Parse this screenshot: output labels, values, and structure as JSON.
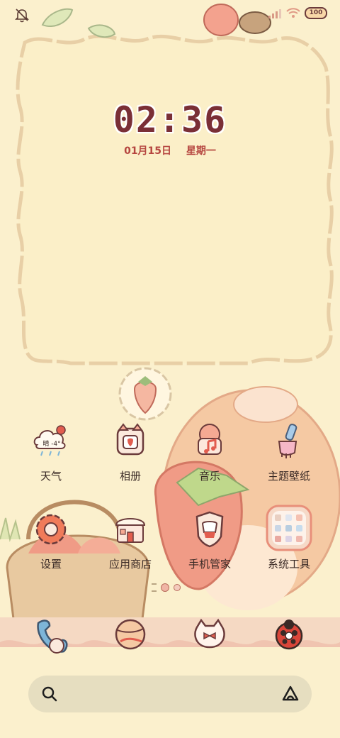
{
  "status_bar": {
    "battery": "100",
    "icons": [
      "mute-bell-icon",
      "signal-icon",
      "wifi-icon",
      "battery-icon"
    ]
  },
  "lockclock": {
    "time": "02:36",
    "date": "01月15日",
    "weekday": "星期一"
  },
  "apps": [
    {
      "label": "天气",
      "icon": "weather-icon",
      "weather_text": "晴 -4°"
    },
    {
      "label": "相册",
      "icon": "album-icon"
    },
    {
      "label": "音乐",
      "icon": "music-icon"
    },
    {
      "label": "主题壁纸",
      "icon": "theme-icon"
    },
    {
      "label": "设置",
      "icon": "settings-icon"
    },
    {
      "label": "应用商店",
      "icon": "app-store-icon"
    },
    {
      "label": "手机管家",
      "icon": "phone-manager-icon"
    },
    {
      "label": "系统工具",
      "icon": "system-tools-folder-icon"
    }
  ],
  "dock": [
    {
      "icon": "phone-icon"
    },
    {
      "icon": "browser-icon"
    },
    {
      "icon": "messages-icon"
    },
    {
      "icon": "camera-icon"
    }
  ],
  "search_bar": {
    "icon_left": "search-icon",
    "icon_right": "assistant-icon"
  },
  "colors": {
    "background": "#fbf0cd",
    "clock_text": "#7a2f36",
    "date_text": "#b5453f",
    "search_bar": "#e6dec0"
  }
}
